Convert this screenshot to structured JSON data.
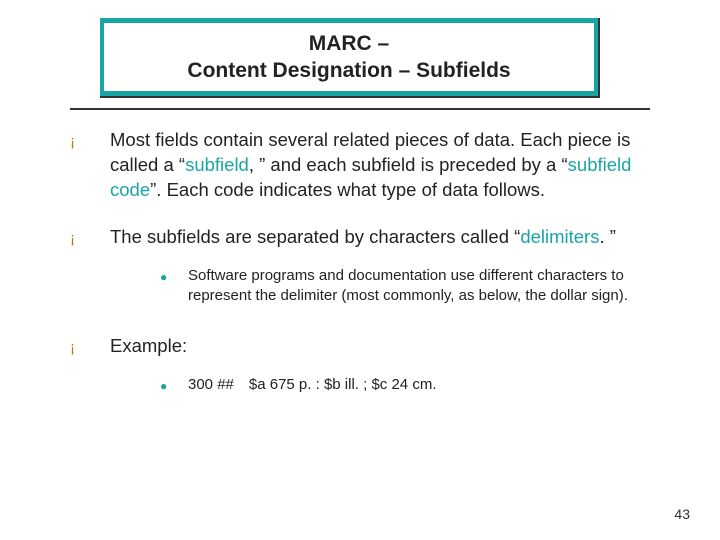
{
  "title": {
    "line1": "MARC –",
    "line2": "Content Designation – Subfields"
  },
  "bullets": [
    {
      "parts": [
        {
          "t": "Most fields contain several related pieces of data.  Each piece is called a “"
        },
        {
          "t": "subfield",
          "cls": "teal"
        },
        {
          "t": ", ” and each subfield is preceded by a “"
        },
        {
          "t": "subfield code",
          "cls": "teal"
        },
        {
          "t": "”.  Each code indicates what type of data follows."
        }
      ]
    },
    {
      "parts": [
        {
          "t": "The subfields are separated by characters called “"
        },
        {
          "t": "delimiters",
          "cls": "teal"
        },
        {
          "t": ". ”"
        }
      ],
      "subs": [
        {
          "t": "Software programs and documentation use different characters to represent the delimiter (most commonly, as below, the dollar sign)."
        }
      ]
    },
    {
      "parts": [
        {
          "t": "Example:"
        }
      ],
      "subs": [
        {
          "t": "300 ## $a 675 p. : $b ill. ; $c 24 cm."
        }
      ]
    }
  ],
  "page_number": "43"
}
